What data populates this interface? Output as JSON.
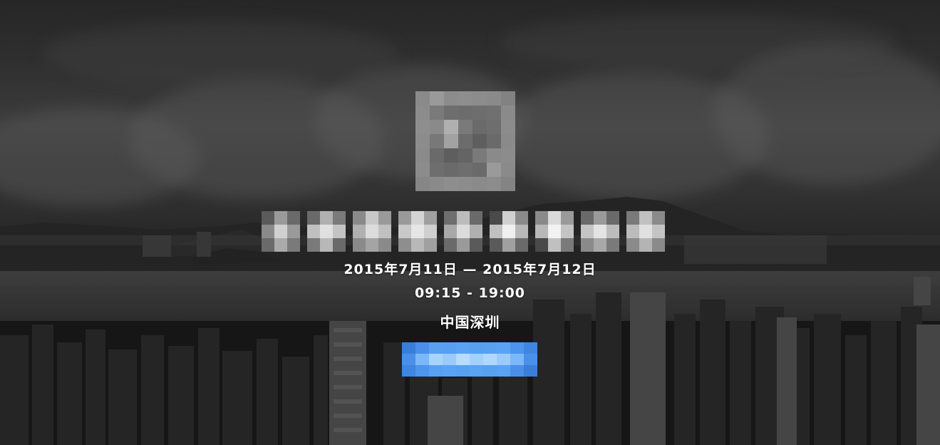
{
  "event": {
    "date_range": "2015年7月11日 — 2015年7月12日",
    "time_range": "09:15 - 19:00",
    "location": "中国深圳"
  },
  "logo": {
    "icon": "event-logo-icon",
    "pixelated": true
  },
  "title": {
    "pixelated": true
  },
  "register_button": {
    "pixelated": true,
    "color": "#4a9af0"
  },
  "colors": {
    "text": "#ffffff",
    "button_accent": "#4a9af0",
    "background": "#2a2a2a"
  }
}
